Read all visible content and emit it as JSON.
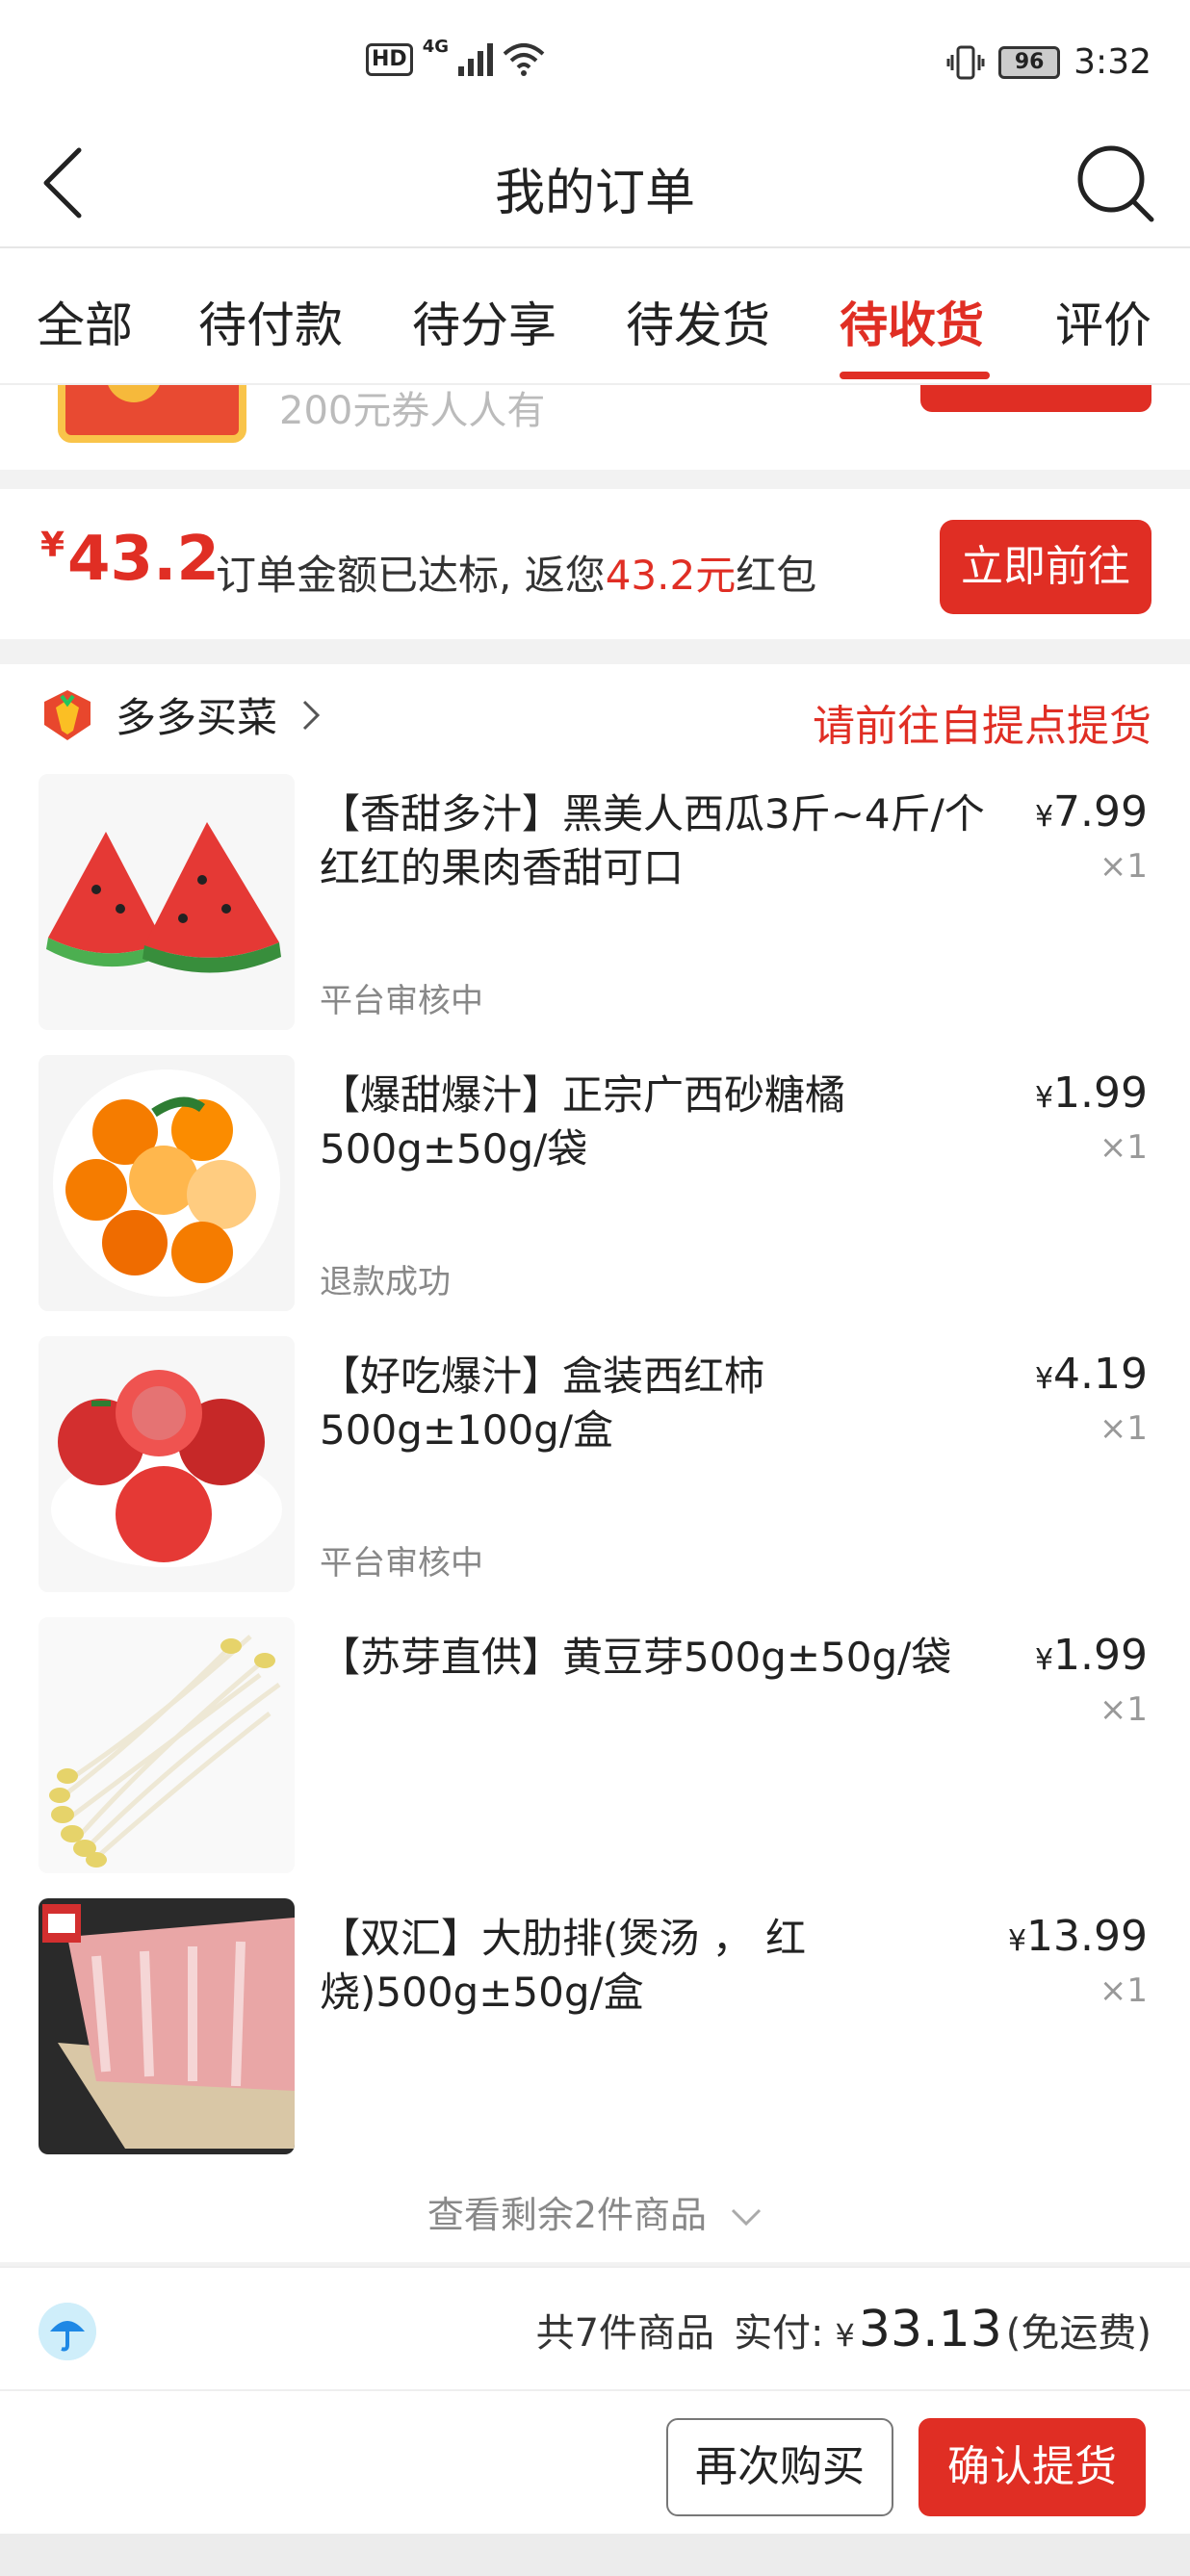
{
  "status_bar": {
    "hd": "HD",
    "network": "4G",
    "battery": "96",
    "time": "3:32"
  },
  "header": {
    "title": "我的订单"
  },
  "tabs": [
    {
      "label": "全部"
    },
    {
      "label": "待付款"
    },
    {
      "label": "待分享"
    },
    {
      "label": "待发货"
    },
    {
      "label": "待收货",
      "active": true
    },
    {
      "label": "评价"
    }
  ],
  "promo": {
    "coin": "¥",
    "text": "200元券人人有"
  },
  "rebate": {
    "yen": "¥",
    "amount": "43.2",
    "text_before": "订单金额已达标, 返您",
    "text_highlight": "43.2元",
    "text_after": "红包",
    "button": "立即前往"
  },
  "order": {
    "shop_name": "多多买菜",
    "pickup_notice": "请前往自提点提货",
    "items": [
      {
        "name": "【香甜多汁】黑美人西瓜3斤~4斤/个红红的果肉香甜可口",
        "price": "7.99",
        "qty": "×1",
        "status": "平台审核中",
        "image_icon": "watermelon-icon"
      },
      {
        "name": "【爆甜爆汁】正宗广西砂糖橘500g±50g/袋",
        "price": "1.99",
        "qty": "×1",
        "status": "退款成功",
        "image_icon": "orange-icon"
      },
      {
        "name": "【好吃爆汁】盒装西红柿500g±100g/盒",
        "price": "4.19",
        "qty": "×1",
        "status": "平台审核中",
        "image_icon": "tomato-icon"
      },
      {
        "name": "【苏芽直供】黄豆芽500g±50g/袋",
        "price": "1.99",
        "qty": "×1",
        "status": "",
        "image_icon": "bean-sprout-icon"
      },
      {
        "name": "【双汇】大肋排(煲汤 ， 红烧)500g±50g/盒",
        "price": "13.99",
        "qty": "×1",
        "status": "",
        "image_icon": "pork-ribs-icon"
      }
    ],
    "yen": "¥",
    "view_more": "查看剩余2件商品"
  },
  "summary": {
    "count_text": "共7件商品",
    "paid_label": "实付:",
    "yen": "¥",
    "paid_amount": "33.13",
    "shipping": "(免运费)"
  },
  "actions": {
    "buy_again": "再次购买",
    "confirm": "确认提货"
  },
  "colors": {
    "accent": "#e02e24"
  }
}
